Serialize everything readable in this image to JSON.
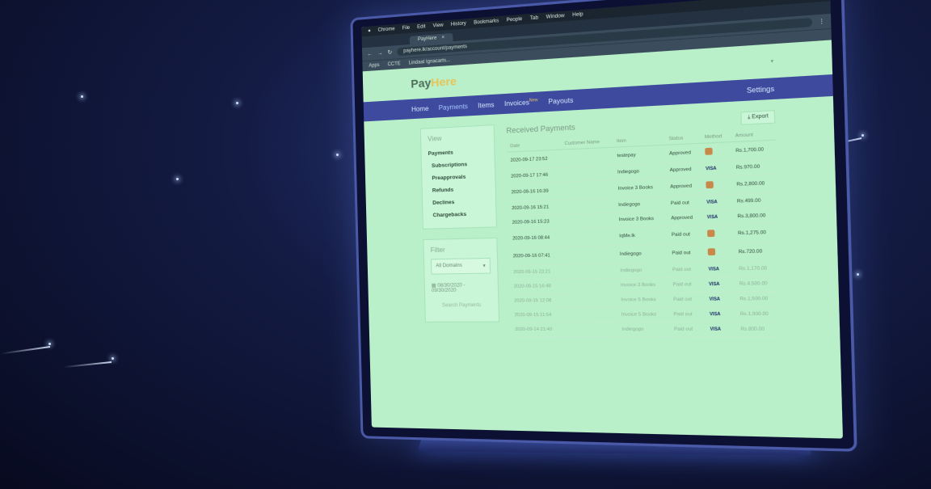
{
  "menubar": {
    "items": [
      "Chrome",
      "File",
      "Edit",
      "View",
      "History",
      "Bookmarks",
      "People",
      "Tab",
      "Window",
      "Help"
    ]
  },
  "browser": {
    "tab_label": "PayHere",
    "url": "payhere.lk/account/payments",
    "bookmarks": [
      "Apps",
      "CCTE",
      "Lindaat Ignacarts..."
    ]
  },
  "app": {
    "logo_pay": "Pay",
    "logo_here": "Here",
    "nav": [
      {
        "label": "Home"
      },
      {
        "label": "Payments"
      },
      {
        "label": "Items"
      },
      {
        "label": "Invoices",
        "badge": "New"
      },
      {
        "label": "Payouts"
      }
    ],
    "settings_label": "Settings",
    "view_panel": {
      "title": "View",
      "items": [
        "Payments",
        "Subscriptions",
        "Preapprovals",
        "Refunds",
        "Declines",
        "Chargebacks"
      ]
    },
    "filter_panel": {
      "title": "Filter",
      "domain_value": "All Domains",
      "date_range": "08/30/2020 - 09/30/2020",
      "search_label": "Search Payments"
    },
    "payments": {
      "title": "Received Payments",
      "export_label": "Export",
      "columns": [
        "Date",
        "Customer Name",
        "Item",
        "Status",
        "Method",
        "Amount"
      ],
      "rows": [
        {
          "date": "2020-09-17 23:52",
          "customer": "",
          "item": "testepay",
          "status": "Approved",
          "method": "icon",
          "amount": "Rs.1,700.00"
        },
        {
          "date": "2020-09-17 17:46",
          "customer": "",
          "item": "Indiegogo",
          "status": "Approved",
          "method": "VISA",
          "amount": "Rs.970.00"
        },
        {
          "date": "2020-09-16 16:39",
          "customer": "",
          "item": "Invoice 3 Books",
          "status": "Approved",
          "method": "icon",
          "amount": "Rs.2,800.00"
        },
        {
          "date": "2020-09-16 15:21",
          "customer": "",
          "item": "Indiegogo",
          "status": "Paid out",
          "method": "VISA",
          "amount": "Rs.499.00"
        },
        {
          "date": "2020-09-16 15:23",
          "customer": "",
          "item": "Invoice 3 Books",
          "status": "Approved",
          "method": "VISA",
          "amount": "Rs.3,800.00"
        },
        {
          "date": "2020-09-16 08:44",
          "customer": "",
          "item": "IqMe.lk",
          "status": "Paid out",
          "method": "icon",
          "amount": "Rs.1,275.00"
        },
        {
          "date": "2020-09-16 07:41",
          "customer": "",
          "item": "Indiegogo",
          "status": "Paid out",
          "method": "icon",
          "amount": "Rs.720.00"
        },
        {
          "date": "2020-09-15 23:21",
          "customer": "",
          "item": "Indiegogo",
          "status": "Paid out",
          "method": "VISA",
          "amount": "Rs.1,170.00"
        },
        {
          "date": "2020-09-15 16:48",
          "customer": "",
          "item": "Invoice 3 Books",
          "status": "Paid out",
          "method": "VISA",
          "amount": "Rs.4,500.00"
        },
        {
          "date": "2020-09-15 12:08",
          "customer": "",
          "item": "Invoice 5 Books",
          "status": "Paid out",
          "method": "VISA",
          "amount": "Rs.1,500.00"
        },
        {
          "date": "2020-09-15 11:54",
          "customer": "",
          "item": "Invoice 5 Books",
          "status": "Paid out",
          "method": "VISA",
          "amount": "Rs.1,900.00"
        },
        {
          "date": "2020-09-14 21:40",
          "customer": "",
          "item": "Indiegogo",
          "status": "Paid out",
          "method": "VISA",
          "amount": "Rs.800.00"
        }
      ]
    }
  }
}
